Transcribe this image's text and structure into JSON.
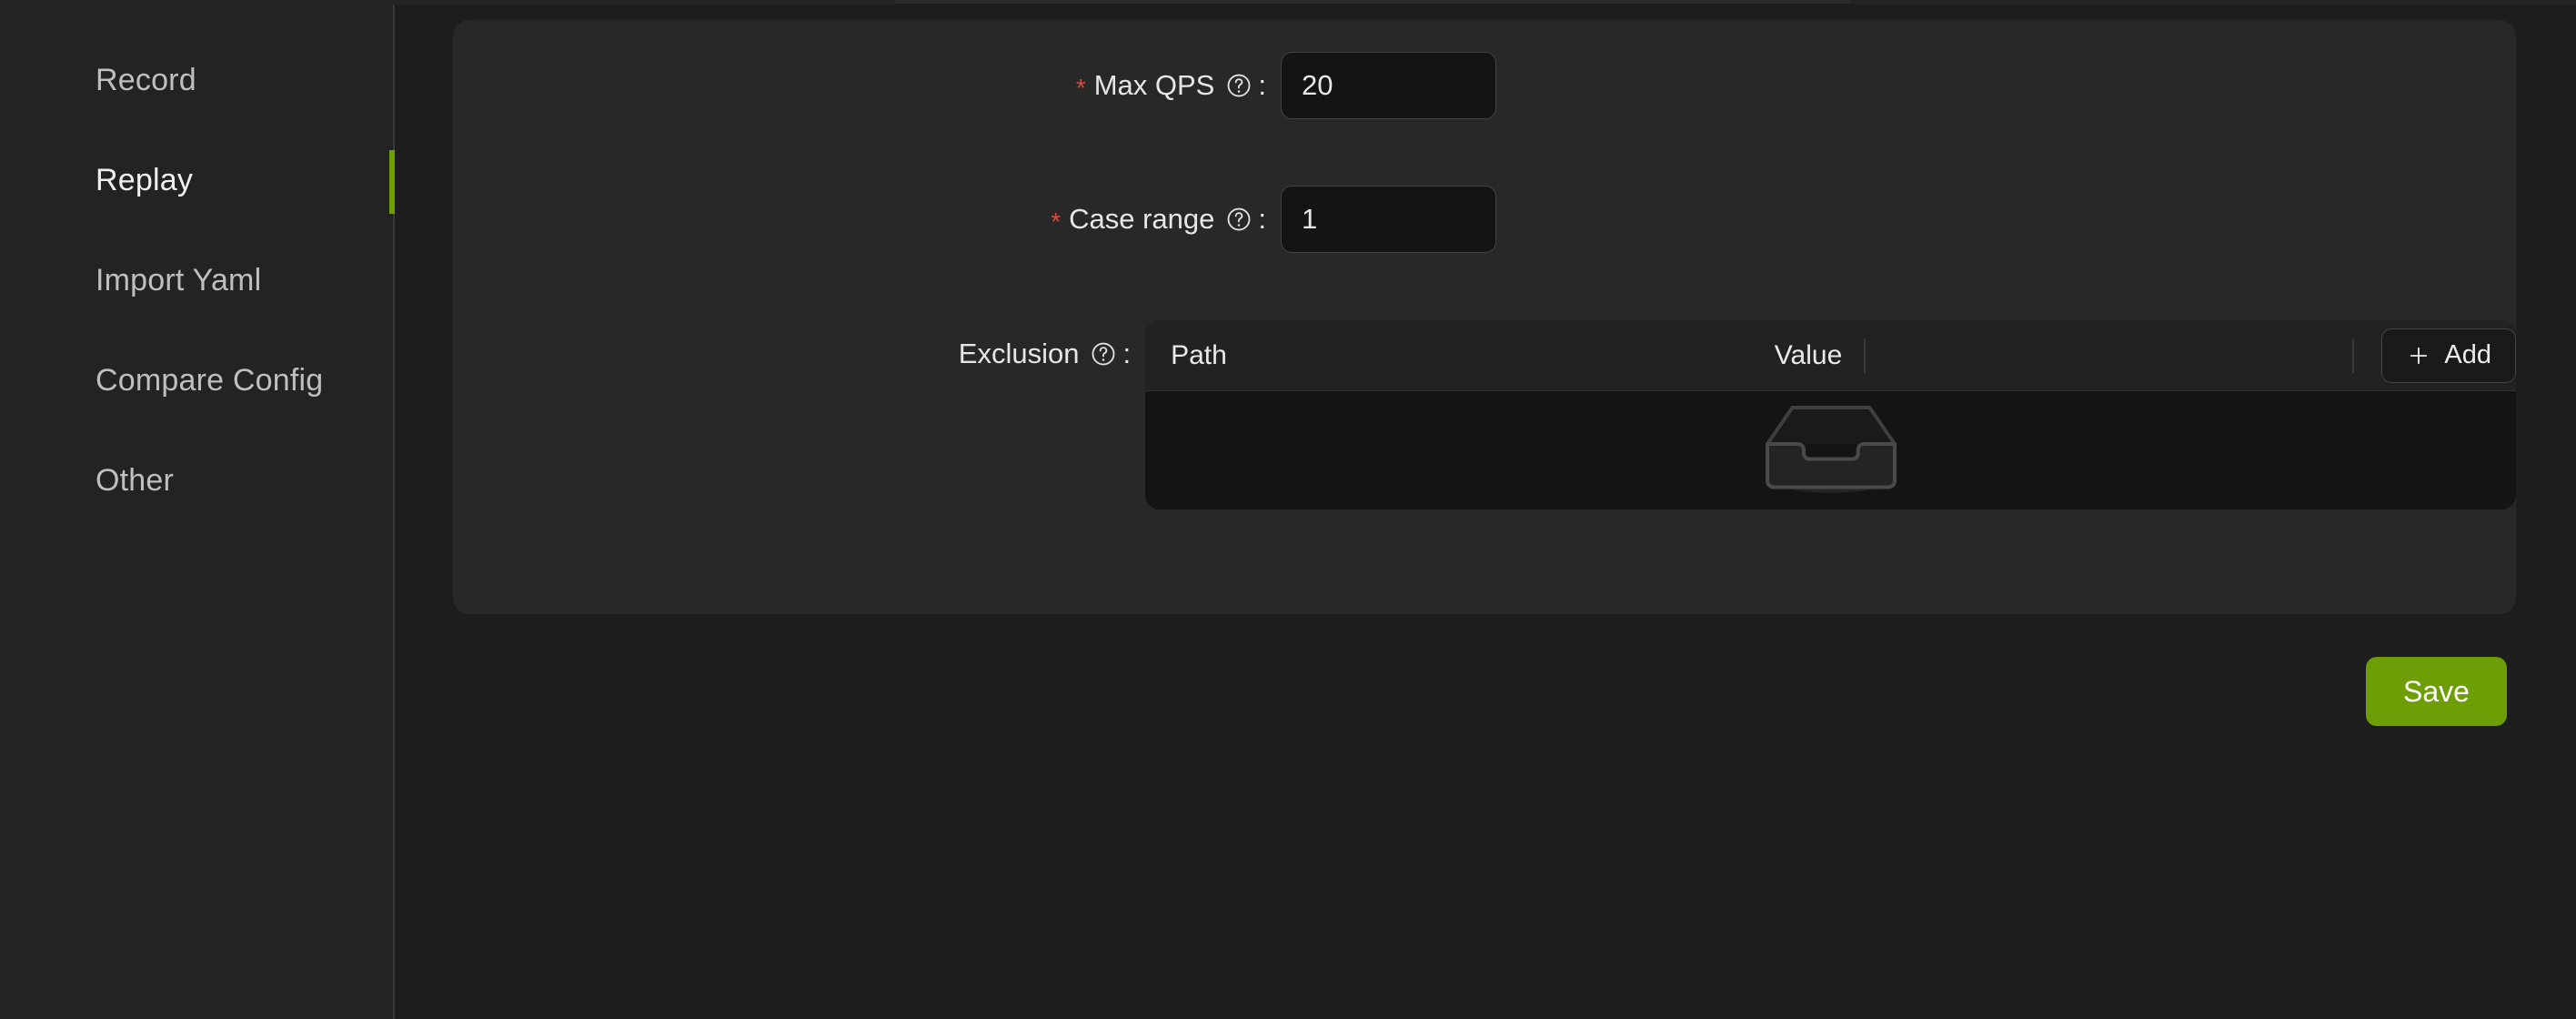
{
  "sidebar": {
    "items": [
      {
        "label": "Record",
        "active": false,
        "name": "sidebar-item-record"
      },
      {
        "label": "Replay",
        "active": true,
        "name": "sidebar-item-replay"
      },
      {
        "label": "Import Yaml",
        "active": false,
        "name": "sidebar-item-import-yaml"
      },
      {
        "label": "Compare Config",
        "active": false,
        "name": "sidebar-item-compare-config"
      },
      {
        "label": "Other",
        "active": false,
        "name": "sidebar-item-other"
      }
    ]
  },
  "form": {
    "max_qps": {
      "label": "Max QPS",
      "required_marker": "*",
      "colon": ":",
      "value": "20",
      "placeholder": "",
      "help_icon": "question-circle-icon"
    },
    "case_range": {
      "label": "Case range",
      "required_marker": "*",
      "colon": ":",
      "value": "1",
      "placeholder": "",
      "help_icon": "question-circle-icon"
    },
    "exclusion": {
      "label": "Exclusion",
      "colon": ":",
      "help_icon": "question-circle-icon",
      "table": {
        "columns": [
          "Path",
          "Value"
        ],
        "rows": [],
        "add_label": "Add",
        "add_icon": "plus-icon",
        "empty_icon": "empty-inbox-icon"
      }
    }
  },
  "actions": {
    "save_label": "Save"
  },
  "colors": {
    "accent_green": "#6d9e06",
    "required_red": "#d94b42",
    "page_bg": "#1d1d1d",
    "card_bg": "#282828",
    "input_bg": "#141414"
  }
}
